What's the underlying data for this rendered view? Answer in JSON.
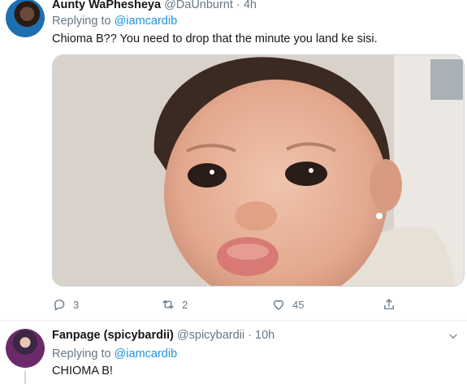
{
  "tweets": [
    {
      "author_name": "Aunty WaPhesheya",
      "author_handle": "@DaUnburnt",
      "separator": "·",
      "time": "4h",
      "replying_prefix": "Replying to",
      "replying_to": "@iamcardib",
      "text": "Chioma B?? You need to drop that the minute you land ke sisi.",
      "actions": {
        "replies": "3",
        "retweets": "2",
        "likes": "45"
      }
    },
    {
      "author_name": "Fanpage (spicybardii)",
      "author_handle": "@spicybardii",
      "separator": "·",
      "time": "10h",
      "replying_prefix": "Replying to",
      "replying_to": "@iamcardib",
      "text": "CHIOMA B!"
    }
  ],
  "icons": {
    "reply": "reply-icon",
    "retweet": "retweet-icon",
    "like": "heart-icon",
    "share": "share-icon",
    "more": "chevron-down-icon"
  },
  "colors": {
    "link": "#1b95e0",
    "secondary_text": "#657786",
    "primary_text": "#14171a",
    "divider": "#e6ecf0"
  }
}
